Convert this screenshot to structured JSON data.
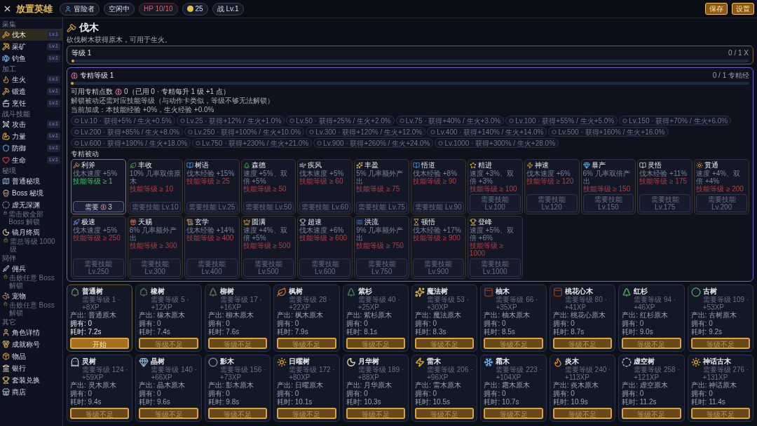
{
  "app": {
    "title": "放置英雄"
  },
  "status_chips": [
    {
      "kind": "player",
      "text": "冒险者"
    },
    {
      "kind": "plain",
      "text": "空闲中"
    },
    {
      "kind": "hp",
      "text": "HP 10/10"
    },
    {
      "kind": "coin",
      "text": "25"
    },
    {
      "kind": "plain",
      "text": "战 Lv.1"
    }
  ],
  "header_buttons": [
    "保存",
    "设置"
  ],
  "sidebar": [
    {
      "section": "采集",
      "items": [
        {
          "label": "伐木",
          "badge": "Lv.1",
          "selected": true
        },
        {
          "label": "采矿",
          "badge": "Lv.1",
          "selected": false
        },
        {
          "label": "钓鱼",
          "badge": "Lv.1",
          "selected": false
        }
      ]
    },
    {
      "section": "加工",
      "items": [
        {
          "label": "生火",
          "badge": "Lv.1",
          "selected": false
        },
        {
          "label": "锻造",
          "badge": "Lv.1",
          "selected": false
        },
        {
          "label": "烹饪",
          "badge": "Lv.1",
          "selected": false
        }
      ]
    },
    {
      "section": "战斗技能",
      "items": [
        {
          "label": "攻击",
          "badge": "Lv.1",
          "selected": false
        },
        {
          "label": "力量",
          "badge": "Lv.1",
          "selected": false
        },
        {
          "label": "防御",
          "badge": "Lv.1",
          "selected": false
        },
        {
          "label": "生命",
          "badge": "Lv.1",
          "selected": false
        }
      ]
    },
    {
      "section": "秘境",
      "items": [
        {
          "label": "普通秘境",
          "selected": false
        },
        {
          "label": "Boss 秘境",
          "selected": false
        },
        {
          "label": "虚无深渊",
          "note": "需击败全部 Boss 解锁",
          "selected": false
        },
        {
          "label": "镜月终焉",
          "note": "需总等级 1000 级",
          "selected": false
        }
      ]
    },
    {
      "section": "同伴",
      "items": [
        {
          "label": "佣兵",
          "note": "击败任意 Boss 解锁",
          "selected": false
        },
        {
          "label": "宠物",
          "note": "击败任意 Boss 解锁",
          "selected": false
        }
      ]
    },
    {
      "section": "其它",
      "items": [
        {
          "label": "角色详情",
          "selected": false
        },
        {
          "label": "成就称号",
          "selected": false
        },
        {
          "label": "物品",
          "selected": false
        },
        {
          "label": "银行",
          "selected": false
        },
        {
          "label": "套装兑换",
          "selected": false
        },
        {
          "label": "商店",
          "selected": false
        }
      ]
    }
  ],
  "page": {
    "title": "伐木",
    "description": "砍伐树木获得原木，可用于生火。"
  },
  "skill_level": {
    "label": "等级 1",
    "progress": "0 / 1 X",
    "level": 0
  },
  "mastery": {
    "title": "专精等级 1",
    "progress": "0 / 1 专精经",
    "level": 0,
    "points_label": "可用专精点数",
    "points_value": "0（已用 0 · 专精每升 1 级 +1 点）",
    "lines": [
      "解锁被动还需对应技能等级（与动作卡类似，等级不够无法解锁）",
      "当前加成：本技能经验 +0%，生火经验 +0.0%"
    ],
    "milestones": [
      {
        "text": "Lv.10 · 获得+5% / 生火+0.5%",
        "reached": false
      },
      {
        "text": "Lv.25 · 获得+12% / 生火+1.0%",
        "reached": false
      },
      {
        "text": "Lv.50 · 获得+25% / 生火+2.0%",
        "reached": false
      },
      {
        "text": "Lv.75 · 获得+40% / 生火+3.0%",
        "reached": false
      },
      {
        "text": "Lv.100 · 获得+55% / 生火+5.0%",
        "reached": false
      },
      {
        "text": "Lv.150 · 获得+70% / 生火+6.0%",
        "reached": false
      },
      {
        "text": "Lv.200 · 获得+85% / 生火+8.0%",
        "reached": false
      },
      {
        "text": "Lv.250 · 获得+100% / 生火+10.0%",
        "reached": false
      },
      {
        "text": "Lv.300 · 获得+120% / 生火+12.0%",
        "reached": false
      },
      {
        "text": "Lv.400 · 获得+140% / 生火+14.0%",
        "reached": false
      },
      {
        "text": "Lv.500 · 获得+160% / 生火+16.0%",
        "reached": false
      },
      {
        "text": "Lv.600 · 获得+190% / 生火+18.0%",
        "reached": false
      },
      {
        "text": "Lv.750 · 获得+230% / 生火+21.0%",
        "reached": false
      },
      {
        "text": "Lv.900 · 获得+260% / 生火+24.0%",
        "reached": false
      },
      {
        "text": "Lv.1000 · 获得+300% / 生火+28.0%",
        "reached": false
      }
    ],
    "passives_title": "专精被动",
    "passives": [
      {
        "name": "利斧",
        "effect": "伐木速度 +5%",
        "requirement": "技能等级 ≥ 1",
        "met": true,
        "button": {
          "kind": "points",
          "label": "需要",
          "cost": "3"
        }
      },
      {
        "name": "丰收",
        "effect": "10% 几率双倍原木",
        "requirement": "技能等级 ≥ 10",
        "met": false,
        "button": {
          "kind": "level",
          "label": "需要技能 Lv.10"
        }
      },
      {
        "name": "树语",
        "effect": "伐木经验 +15%",
        "requirement": "技能等级 ≥ 25",
        "met": false,
        "button": {
          "kind": "level",
          "label": "需要技能 Lv.25"
        }
      },
      {
        "name": "森德",
        "effect": "速度 +5%、双倍 +5%",
        "requirement": "技能等级 ≥ 50",
        "met": false,
        "button": {
          "kind": "level",
          "label": "需要技能 Lv.50"
        }
      },
      {
        "name": "疾风",
        "effect": "伐木速度 +5%",
        "requirement": "技能等级 ≥ 60",
        "met": false,
        "button": {
          "kind": "level",
          "label": "需要技能 Lv.60"
        }
      },
      {
        "name": "丰盈",
        "effect": "5% 几率额外产出",
        "requirement": "技能等级 ≥ 75",
        "met": false,
        "button": {
          "kind": "level",
          "label": "需要技能 Lv.75"
        }
      },
      {
        "name": "悟道",
        "effect": "伐木经验 +8%",
        "requirement": "技能等级 ≥ 90",
        "met": false,
        "button": {
          "kind": "level",
          "label": "需要技能 Lv.90"
        }
      },
      {
        "name": "精进",
        "effect": "速度 +3%、双倍 +3%",
        "requirement": "技能等级 ≥ 100",
        "met": false,
        "button": {
          "kind": "level",
          "label": "需要技能 Lv.100"
        }
      },
      {
        "name": "神速",
        "effect": "伐木速度 +6%",
        "requirement": "技能等级 ≥ 120",
        "met": false,
        "button": {
          "kind": "level",
          "label": "需要技能 Lv.120"
        }
      },
      {
        "name": "暴产",
        "effect": "6% 几率双倍产出",
        "requirement": "技能等级 ≥ 150",
        "met": false,
        "button": {
          "kind": "level",
          "label": "需要技能 Lv.150"
        }
      },
      {
        "name": "灵悟",
        "effect": "伐木经验 +11%",
        "requirement": "技能等级 ≥ 175",
        "met": false,
        "button": {
          "kind": "level",
          "label": "需要技能 Lv.175"
        }
      },
      {
        "name": "贯通",
        "effect": "速度 +4%、双倍 +4%",
        "requirement": "技能等级 ≥ 200",
        "met": false,
        "button": {
          "kind": "level",
          "label": "需要技能 Lv.200"
        }
      },
      {
        "name": "极速",
        "effect": "伐木速度 +5%",
        "requirement": "技能等级 ≥ 250",
        "met": false,
        "button": {
          "kind": "level",
          "label": "需要技能 Lv.250"
        }
      },
      {
        "name": "天赐",
        "effect": "8% 几率额外产出",
        "requirement": "技能等级 ≥ 300",
        "met": false,
        "button": {
          "kind": "level",
          "label": "需要技能 Lv.300"
        }
      },
      {
        "name": "玄学",
        "effect": "伐木经验 +14%",
        "requirement": "技能等级 ≥ 400",
        "met": false,
        "button": {
          "kind": "level",
          "label": "需要技能 Lv.400"
        }
      },
      {
        "name": "圆满",
        "effect": "速度 +4%、双倍 +5%",
        "requirement": "技能等级 ≥ 500",
        "met": false,
        "button": {
          "kind": "level",
          "label": "需要技能 Lv.500"
        }
      },
      {
        "name": "超速",
        "effect": "伐木速度 +6%",
        "requirement": "技能等级 ≥ 600",
        "met": false,
        "button": {
          "kind": "level",
          "label": "需要技能 Lv.600"
        }
      },
      {
        "name": "洪流",
        "effect": "9% 几率额外产出",
        "requirement": "技能等级 ≥ 750",
        "met": false,
        "button": {
          "kind": "level",
          "label": "需要技能 Lv.750"
        }
      },
      {
        "name": "顿悟",
        "effect": "伐木经验 +17%",
        "requirement": "技能等级 ≥ 900",
        "met": false,
        "button": {
          "kind": "level",
          "label": "需要技能 Lv.900"
        }
      },
      {
        "name": "登峰",
        "effect": "速度 +5%、双倍 +6%",
        "requirement": "技能等级 ≥ 1000",
        "met": false,
        "button": {
          "kind": "level",
          "label": "需要技能 Lv.1000"
        }
      }
    ]
  },
  "trees": [
    {
      "name": "普通树",
      "requirement": "需要等级 1 · +8XP",
      "output": "产出: 普通原木",
      "owned": "拥有: 0",
      "time": "耗时: 7.2s",
      "button": "开始",
      "locked": false
    },
    {
      "name": "橡树",
      "requirement": "需要等级 5 · +12XP",
      "output": "产出: 橡木原木",
      "owned": "拥有: 0",
      "time": "耗时: 7.4s",
      "button": "等级不足",
      "locked": true
    },
    {
      "name": "柳树",
      "requirement": "需要等级 17 · +16XP",
      "output": "产出: 柳木原木",
      "owned": "拥有: 0",
      "time": "耗时: 7.6s",
      "button": "等级不足",
      "locked": true
    },
    {
      "name": "枫树",
      "requirement": "需要等级 28 · +22XP",
      "output": "产出: 枫木原木",
      "owned": "拥有: 0",
      "time": "耗时: 7.9s",
      "button": "等级不足",
      "locked": true
    },
    {
      "name": "紫杉",
      "requirement": "需要等级 40 · +25XP",
      "output": "产出: 紫杉原木",
      "owned": "拥有: 0",
      "time": "耗时: 8.1s",
      "button": "等级不足",
      "locked": true
    },
    {
      "name": "魔法树",
      "requirement": "需要等级 53 · +30XP",
      "output": "产出: 魔法原木",
      "owned": "拥有: 0",
      "time": "耗时: 8.3s",
      "button": "等级不足",
      "locked": true
    },
    {
      "name": "柚木",
      "requirement": "需要等级 66 · +35XP",
      "output": "产出: 柚木原木",
      "owned": "拥有: 0",
      "time": "耗时: 8.5s",
      "button": "等级不足",
      "locked": true
    },
    {
      "name": "桃花心木",
      "requirement": "需要等级 80 · +41XP",
      "output": "产出: 桃花心原木",
      "owned": "拥有: 0",
      "time": "耗时: 8.7s",
      "button": "等级不足",
      "locked": true
    },
    {
      "name": "红杉",
      "requirement": "需要等级 94 · +46XP",
      "output": "产出: 红杉原木",
      "owned": "拥有: 0",
      "time": "耗时: 9.0s",
      "button": "等级不足",
      "locked": true
    },
    {
      "name": "古树",
      "requirement": "需要等级 109 · +53XP",
      "output": "产出: 古树原木",
      "owned": "拥有: 0",
      "time": "耗时: 9.2s",
      "button": "等级不足",
      "locked": true
    },
    {
      "name": "灵树",
      "requirement": "需要等级 124 · +59XP",
      "output": "产出: 灵木原木",
      "owned": "拥有: 0",
      "time": "耗时: 9.4s",
      "button": "等级不足",
      "locked": true
    },
    {
      "name": "晶树",
      "requirement": "需要等级 140 · +66XP",
      "output": "产出: 晶木原木",
      "owned": "拥有: 0",
      "time": "耗时: 9.6s",
      "button": "等级不足",
      "locked": true
    },
    {
      "name": "影木",
      "requirement": "需要等级 156 · +73XP",
      "output": "产出: 影木原木",
      "owned": "拥有: 0",
      "time": "耗时: 9.8s",
      "button": "等级不足",
      "locked": true
    },
    {
      "name": "日曜树",
      "requirement": "需要等级 172 · +80XP",
      "output": "产出: 日曜原木",
      "owned": "拥有: 0",
      "time": "耗时: 10.1s",
      "button": "等级不足",
      "locked": true
    },
    {
      "name": "月华树",
      "requirement": "需要等级 189 · +88XP",
      "output": "产出: 月华原木",
      "owned": "拥有: 0",
      "time": "耗时: 10.3s",
      "button": "等级不足",
      "locked": true
    },
    {
      "name": "雷木",
      "requirement": "需要等级 206 · +96XP",
      "output": "产出: 雷木原木",
      "owned": "拥有: 0",
      "time": "耗时: 10.5s",
      "button": "等级不足",
      "locked": true
    },
    {
      "name": "霜木",
      "requirement": "需要等级 223 · +104XP",
      "output": "产出: 霜木原木",
      "owned": "拥有: 0",
      "time": "耗时: 10.7s",
      "button": "等级不足",
      "locked": true
    },
    {
      "name": "炎木",
      "requirement": "需要等级 240 · +113XP",
      "output": "产出: 炎木原木",
      "owned": "拥有: 0",
      "time": "耗时: 10.9s",
      "button": "等级不足",
      "locked": true
    },
    {
      "name": "虚空树",
      "requirement": "需要等级 258 · +121XP",
      "output": "产出: 虚空原木",
      "owned": "拥有: 0",
      "time": "耗时: 11.2s",
      "button": "等级不足",
      "locked": true
    },
    {
      "name": "神话古木",
      "requirement": "需要等级 276 · +131XP",
      "output": "产出: 神话原木",
      "owned": "拥有: 0",
      "time": "耗时: 11.4s",
      "button": "等级不足",
      "locked": true
    }
  ]
}
